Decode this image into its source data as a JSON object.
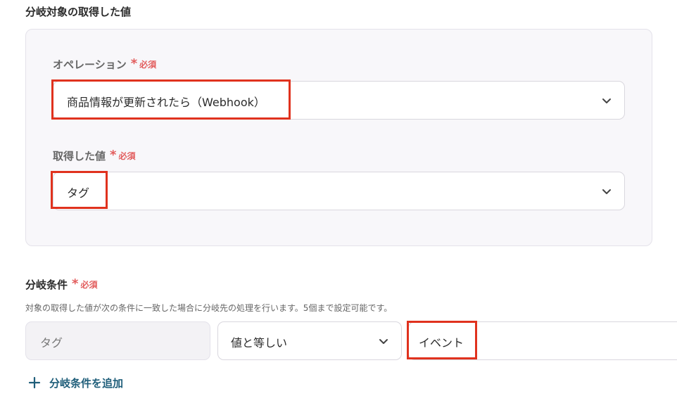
{
  "source_section": {
    "title": "分岐対象の取得した値",
    "operation": {
      "label": "オペレーション",
      "required_mark": "*",
      "required_text": "必須",
      "value": "商品情報が更新されたら（Webhook）"
    },
    "acquired_value": {
      "label": "取得した値",
      "required_mark": "*",
      "required_text": "必須",
      "value": "タグ"
    }
  },
  "condition_section": {
    "title": "分岐条件",
    "required_mark": "*",
    "required_text": "必須",
    "help": "対象の取得した値が次の条件に一致した場合に分岐先の処理を行います。5個まで設定可能です。",
    "row": {
      "field": "タグ",
      "operator": "値と等しい",
      "value": "イベント"
    },
    "add_label": "分岐条件を追加"
  },
  "icons": {
    "chevron": "chevron-down-icon",
    "plus": "plus-icon"
  },
  "colors": {
    "highlight": "#e0321e",
    "required": "#e25c5c",
    "link": "#1f5e7a"
  }
}
